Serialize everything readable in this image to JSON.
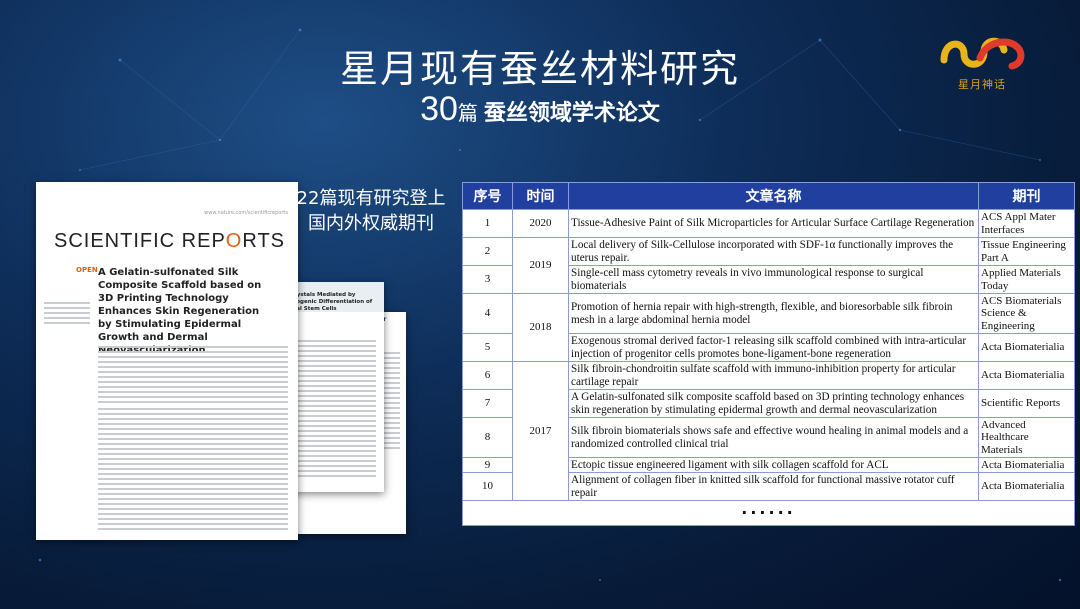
{
  "header": {
    "title": "星月现有蚕丝材料研究",
    "subtitle_num": "30",
    "subtitle_unit": "篇",
    "subtitle_rest": "蚕丝领域学术论文"
  },
  "logo": {
    "text": "星月神话",
    "colors": [
      "#e8b41a",
      "#e03a2a"
    ]
  },
  "side_caption": {
    "line1": "22篇现有研究登上",
    "line2": "国内外权威期刊"
  },
  "paper_preview": {
    "url": "www.nature.com/scientificreports",
    "brand_left": "SCIENTIFIC REP",
    "brand_o": "O",
    "brand_right": "RTS",
    "open_label": "OPEN",
    "title": "A Gelatin-sulfonated Silk Composite Scaffold based on 3D Printing Technology Enhances Skin Regeneration by Stimulating Epidermal Growth and Dermal Neovascularization",
    "second_heading": "Crystals Mediated by ...ogenic Differentiation of ...al Stem Cells",
    "third_heading": "...ings for Articular Surface"
  },
  "table": {
    "headers": {
      "index": "序号",
      "year": "时间",
      "title": "文章名称",
      "journal": "期刊"
    },
    "rows": [
      {
        "index": "1",
        "title": "Tissue-Adhesive Paint of Silk Microparticles for Articular Surface Cartilage Regeneration",
        "journal": "ACS Appl Mater Interfaces"
      },
      {
        "index": "2",
        "title": "Local delivery of Silk-Cellulose incorporated with SDF-1α functionally improves the uterus repair.",
        "journal": " Tissue Engineering Part A"
      },
      {
        "index": "3",
        "title": "Single-cell mass cytometry reveals in vivo immunological response to surgical biomaterials",
        "journal": "Applied Materials Today"
      },
      {
        "index": "4",
        "title": "Promotion of hernia repair with high-strength, flexible, and bioresorbable silk fibroin mesh in a large abdominal hernia model",
        "journal": "ACS Biomaterials Science & Engineering"
      },
      {
        "index": "5",
        "title": "Exogenous stromal derived factor-1 releasing silk scaffold combined with intra-articular injection of progenitor cells promotes bone-ligament-bone regeneration",
        "journal": "Acta Biomaterialia"
      },
      {
        "index": "6",
        "title": "Silk fibroin-chondroitin sulfate scaffold with immuno-inhibition property for articular cartilage repair",
        "journal": "Acta Biomaterialia"
      },
      {
        "index": "7",
        "title": "A Gelatin-sulfonated silk composite scaffold based on 3D printing technology enhances skin regeneration by stimulating epidermal growth and dermal neovascularization",
        "journal": "Scientific Reports"
      },
      {
        "index": "8",
        "title": "Silk fibroin biomaterials shows safe and effective wound healing in animal models and a randomized controlled clinical trial",
        "journal": "Advanced Healthcare Materials"
      },
      {
        "index": "9",
        "title": "Ectopic tissue engineered ligament with silk collagen scaffold for ACL",
        "journal": "Acta Biomaterialia"
      },
      {
        "index": "10",
        "title": "Alignment of collagen fiber in knitted silk scaffold for functional massive rotator cuff repair",
        "journal": "Acta Biomaterialia"
      }
    ],
    "years": {
      "y2020": "2020",
      "y2019": "2019",
      "y2018": "2018",
      "y2017": "2017"
    },
    "more": "······"
  }
}
